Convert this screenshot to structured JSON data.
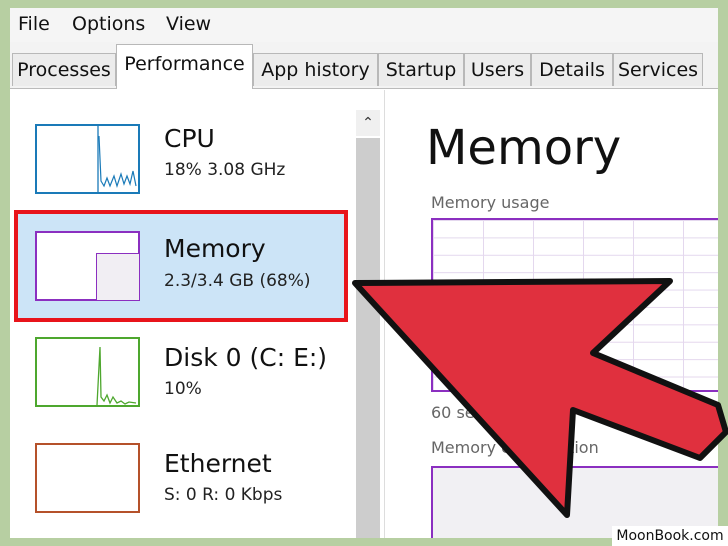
{
  "menu": [
    "File",
    "Options",
    "View"
  ],
  "tabs": [
    {
      "label": "Processes",
      "active": false
    },
    {
      "label": "Performance",
      "active": true
    },
    {
      "label": "App history",
      "active": false
    },
    {
      "label": "Startup",
      "active": false
    },
    {
      "label": "Users",
      "active": false
    },
    {
      "label": "Details",
      "active": false
    },
    {
      "label": "Services",
      "active": false
    }
  ],
  "sidebar": {
    "items": [
      {
        "name": "CPU",
        "detail": "18%  3.08 GHz",
        "color": "#1a7ab8"
      },
      {
        "name": "Memory",
        "detail": "2.3/3.4 GB (68%)",
        "color": "#8b2fc0",
        "selected": true,
        "usage_percent": 68
      },
      {
        "name": "Disk 0 (C: E:)",
        "detail": "10%",
        "color": "#4ea72e"
      },
      {
        "name": "Ethernet",
        "detail": "S: 0 R: 0 Kbps",
        "color": "#b5512a"
      }
    ],
    "scroll_up_icon": "chevron-up-icon"
  },
  "main": {
    "title": "Memory",
    "usage_label": "Memory usage",
    "time_label": "60 se",
    "composition_label": "Memory composition"
  },
  "annotation": {
    "highlight_color": "#e8141b",
    "arrow_color": "#e0303e"
  },
  "watermark": "MoonBook.com",
  "colors": {
    "selected_bg": "#cce4f7",
    "frame": "#b7cfa2"
  }
}
